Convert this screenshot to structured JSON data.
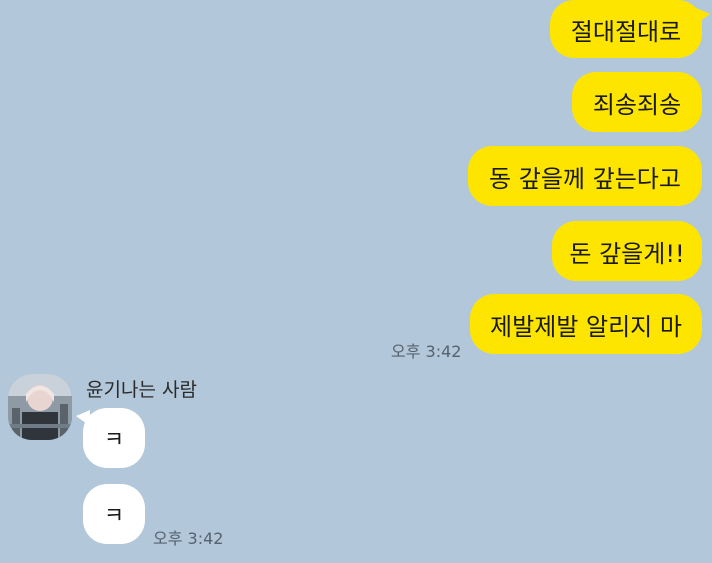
{
  "messages_sent": [
    "절대절대로",
    "죄송죄송",
    "동 갚을께 갚는다고",
    "돈 갚을게!!",
    "제발제발 알리지 마"
  ],
  "sent_time": "오후 3:42",
  "sender": {
    "name": "윤기나는 사람",
    "avatar": "profile-photo"
  },
  "messages_received": [
    "ㅋ",
    "ㅋ"
  ],
  "received_time": "오후 3:42",
  "colors": {
    "background": "#b2c7d9",
    "sent_bubble": "#fee500",
    "received_bubble": "#ffffff"
  }
}
